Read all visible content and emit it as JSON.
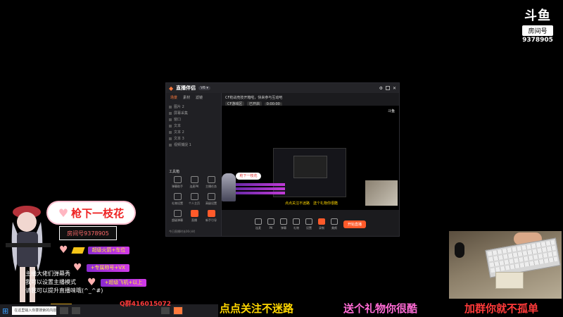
{
  "watermark": {
    "mark": "斗鱼",
    "room_label": "房间号",
    "room_number": "9378905"
  },
  "app": {
    "title": "直播伴侣",
    "version": "V6 ▾",
    "tabs": [
      "场景",
      "素材",
      "滤镜"
    ],
    "scenes": [
      "图片 2",
      "屏幕采集",
      "窗口",
      "文本",
      "文本 2",
      "文本 3",
      "视频捕捉 1"
    ],
    "tools_title": "工具箱",
    "tools": [
      "弹幕助手",
      "连麦PK",
      "主播任务",
      "礼物设置",
      "个人主页",
      "高级设置",
      "超级弹幕",
      "直播",
      "新手引导"
    ],
    "foot": "今日直播时长00小时",
    "info_line": "CF枪战竞技开箱啦，快来参与互动吧",
    "info_pills": [
      "CF游戏区",
      "已开启",
      "0:00:00"
    ],
    "controls": [
      "连麦",
      "PK",
      "弹幕",
      "礼物",
      "设置",
      "录制",
      "美颜"
    ],
    "start_label": "开始直播",
    "preview_bubble": "枪下一枝花",
    "preview_ticker": "点点关注不迷路　送个礼物你很酷"
  },
  "overlay": {
    "streamer_name": "枪下一枝花",
    "room_plate": "房间号9378905",
    "gifts": [
      "超级火箭+车位",
      "+专属称号+VX",
      "+超级飞机+以上"
    ],
    "chat_lines": [
      "主播大佬们弹幕秀",
      "我可以设置主播模式",
      "请我可以提升直播味哦(^_^#)"
    ]
  },
  "taskbar": {
    "search_placeholder": "在这里输入你要搜索的内容"
  },
  "qq": "Q群416015072",
  "slogans": [
    "点点关注不迷路",
    "送个礼物你很酷",
    "加群你就不孤单"
  ],
  "colors": {
    "accent": "#ff5a2a",
    "gift_bar": "#a830d8",
    "slogan_yellow": "#ffd700",
    "slogan_pink": "#ff6bd5",
    "slogan_red": "#ff3a3a"
  }
}
